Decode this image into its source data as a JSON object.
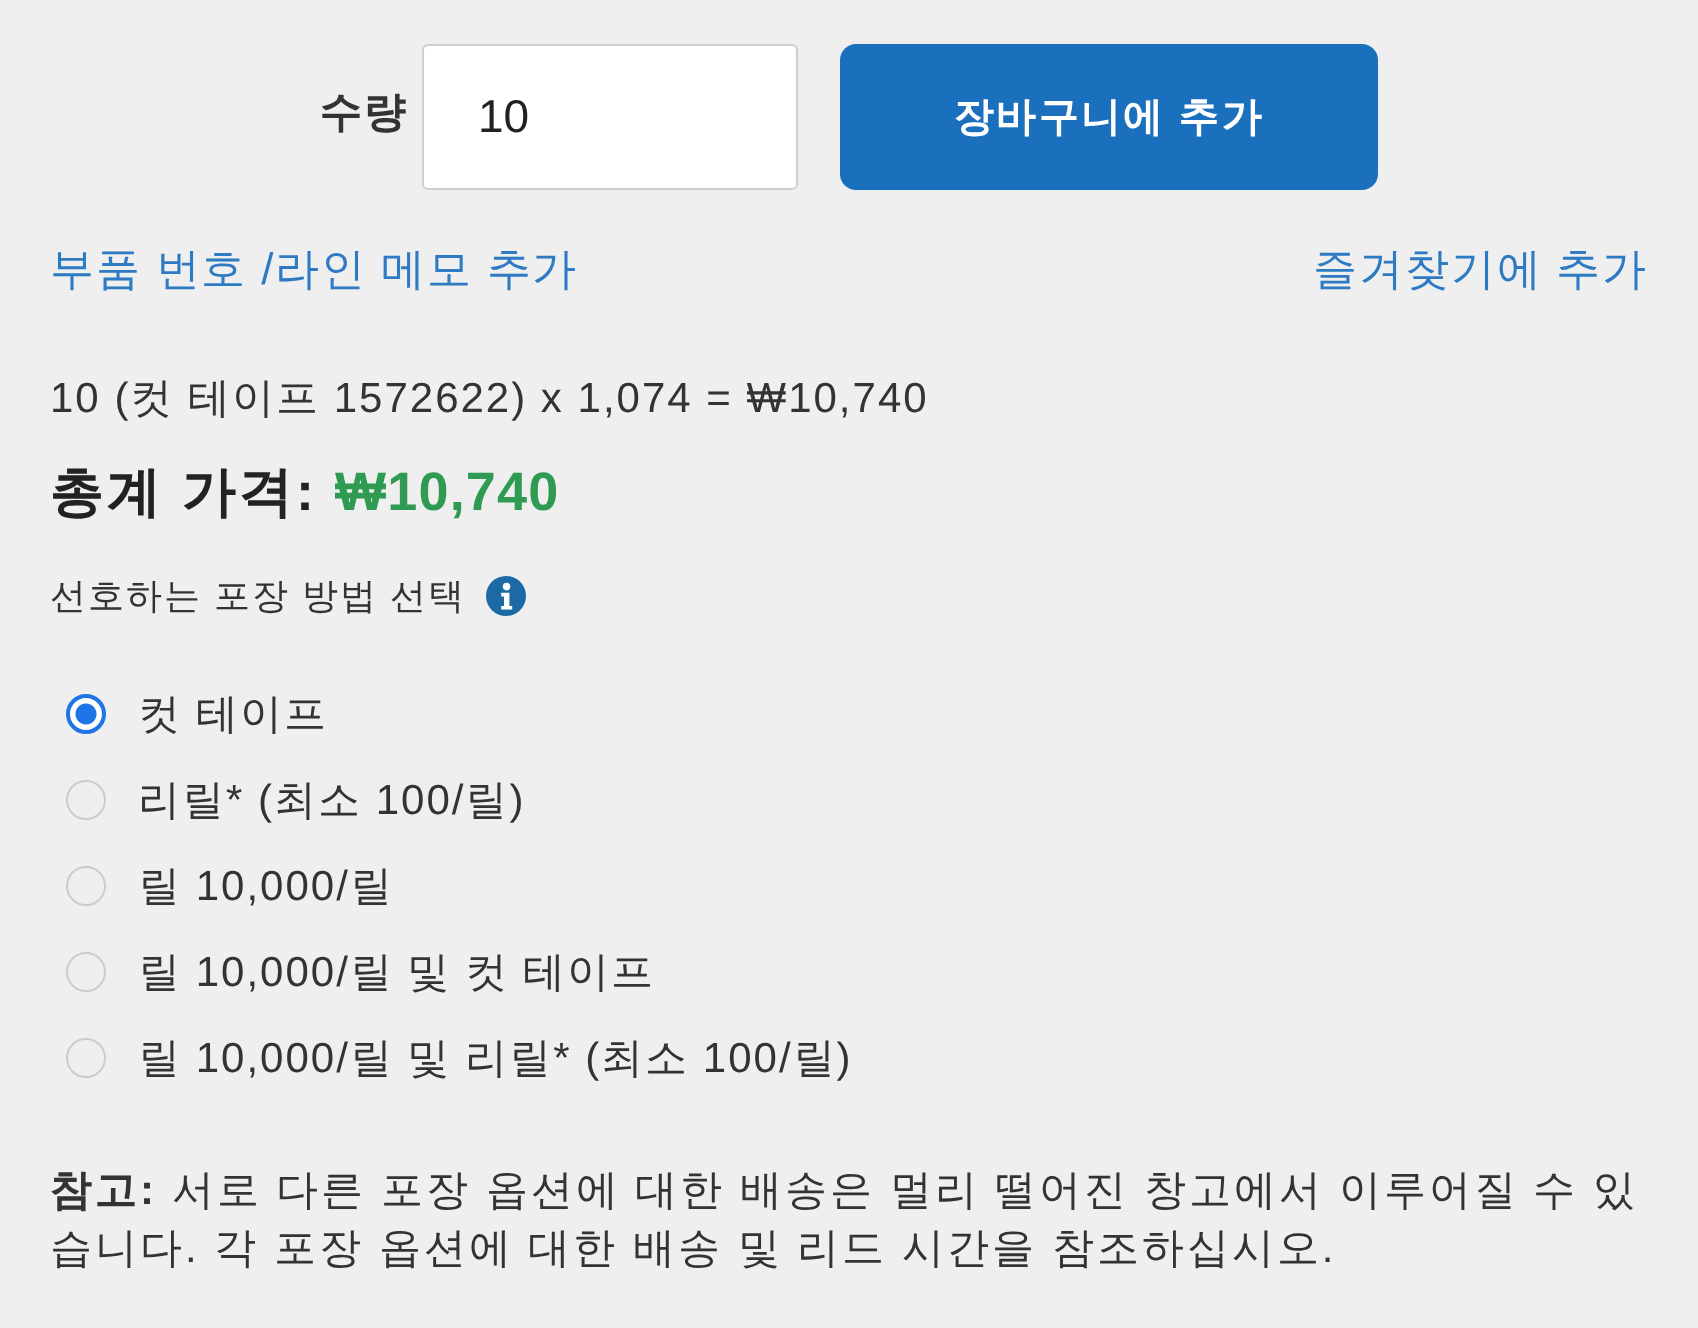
{
  "quantity": {
    "label": "수량",
    "value": "10"
  },
  "add_to_cart_button": "장바구니에 추가",
  "links": [
    {
      "label": "부품 번호 /라인 메모 추가"
    },
    {
      "label": "즐겨찾기에 추가"
    }
  ],
  "price_calculation": "10 (컷 테이프 1572622) x 1,074 = ₩10,740",
  "total": {
    "label": "총계 가격:",
    "amount": "₩10,740"
  },
  "packaging": {
    "label": "선호하는 포장 방법 선택",
    "options": [
      {
        "label": "컷 테이프",
        "selected": true
      },
      {
        "label": "리릴* (최소 100/릴)",
        "selected": false
      },
      {
        "label": "릴 10,000/릴",
        "selected": false
      },
      {
        "label": "릴 10,000/릴 및 컷 테이프",
        "selected": false
      },
      {
        "label": "릴 10,000/릴 및 리릴* (최소 100/릴)",
        "selected": false
      }
    ]
  },
  "note": "**참고:** 서로 다른 포장 옵션에 대한 배송은 멀리 떨어진 창고에서 이루어질 수 있습니다. 각 포장 옵션에 대한 배송 및 리드 시간을 참조하십시오."
}
